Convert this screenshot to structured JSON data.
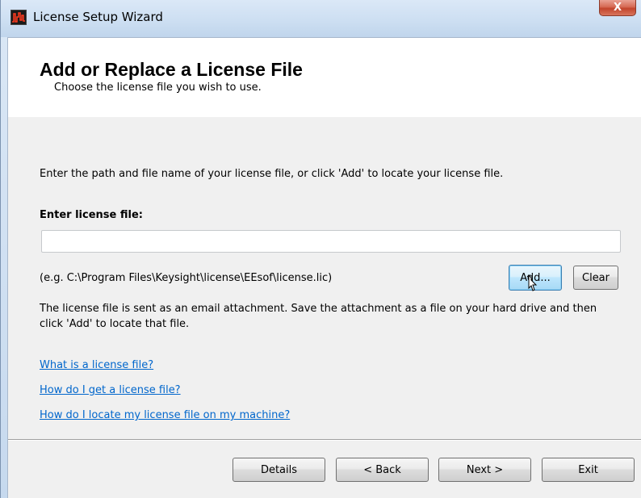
{
  "window": {
    "title": "License Setup Wizard",
    "close_label": "X"
  },
  "header": {
    "title": "Add or Replace a License File",
    "subtitle": "Choose the license file you wish to use."
  },
  "main": {
    "instructions": "Enter the path and file name of your license file, or click 'Add' to locate your license file.",
    "field_label": "Enter license file:",
    "license_input_value": "",
    "example": "(e.g. C:\\Program Files\\Keysight\\license\\EEsof\\license.lic)",
    "add_label": "Add...",
    "clear_label": "Clear",
    "notice": "The license file is sent as an email attachment. Save the attachment as a file on your hard drive and then click 'Add' to locate that file.",
    "links": [
      "What is a license file?",
      "How do I get a license file?",
      "How do I locate my license file on my machine?"
    ]
  },
  "footer": {
    "details_label": "Details",
    "back_label": "< Back",
    "next_label": "Next >",
    "exit_label": "Exit"
  },
  "colors": {
    "link": "#0066cc",
    "close_button": "#c2442c",
    "focused_button_border": "#3c7fb1"
  },
  "icons": {
    "app": "keysight-wave-icon",
    "close": "close-icon",
    "cursor": "mouse-pointer-icon"
  }
}
